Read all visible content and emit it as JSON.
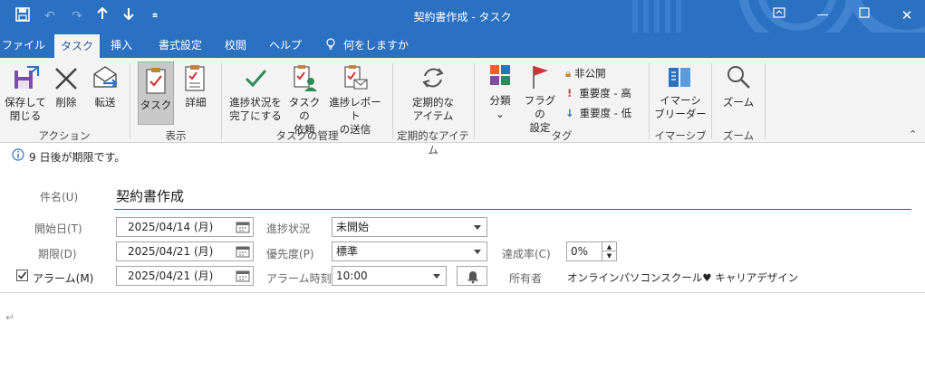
{
  "titlebar": {
    "title": "契約書作成 - タスク",
    "qat_icons": [
      "save-icon",
      "undo-icon",
      "redo-icon",
      "up-arrow-icon",
      "down-arrow-icon",
      "customize-icon"
    ]
  },
  "tabs": [
    {
      "label": "ファイル"
    },
    {
      "label": "タスク"
    },
    {
      "label": "挿入"
    },
    {
      "label": "書式設定"
    },
    {
      "label": "校閲"
    },
    {
      "label": "ヘルプ"
    },
    {
      "label": "何をしますか"
    }
  ],
  "ribbon": {
    "actions": {
      "save_close": "保存して\n閉じる",
      "delete": "削除",
      "forward": "転送",
      "group": "アクション"
    },
    "show": {
      "task": "タスク",
      "details": "詳細",
      "group": "表示"
    },
    "manage": {
      "complete": "進捗状況を\n完了にする",
      "assign": "タスクの\n依頼",
      "send_status": "進捗レポート\nの送信",
      "group": "タスクの管理"
    },
    "recurrence": {
      "recurring": "定期的な\nアイテム",
      "group": "定期的なアイテム"
    },
    "tags": {
      "categorize": "分類",
      "follow_up": "フラグの\n設定",
      "private": "非公開",
      "high": "重要度 - 高",
      "low": "重要度 - 低",
      "group": "タグ"
    },
    "immersive": {
      "reader": "イマーシ\nブリーダー",
      "group": "イマーシブ"
    },
    "zoom": {
      "zoom": "ズーム",
      "group": "ズーム"
    }
  },
  "info": {
    "text": "9 日後が期限です。"
  },
  "form": {
    "subject_label": "件名(U)",
    "subject_value": "契約書作成",
    "start_label": "開始日(T)",
    "start_value": "2025/04/14 (月)",
    "due_label": "期限(D)",
    "due_value": "2025/04/21 (月)",
    "reminder_label": "アラーム(M)",
    "reminder_checked": true,
    "reminder_value": "2025/04/21 (月)",
    "status_label": "進捗状況",
    "status_value": "未開始",
    "priority_label": "優先度(P)",
    "priority_value": "標準",
    "reminder_time_label": "アラーム時刻",
    "reminder_time_value": "10:00",
    "complete_label": "達成率(C)",
    "complete_value": "0%",
    "owner_label": "所有者",
    "owner_value": "オンラインパソコンスクール♥ キャリアデザイン"
  },
  "body": {
    "mark": "↵"
  },
  "colors": {
    "accent": "#2b71c2",
    "ribbon_bg": "#f3f3f3",
    "subject_underline": "#1e6f7a"
  }
}
